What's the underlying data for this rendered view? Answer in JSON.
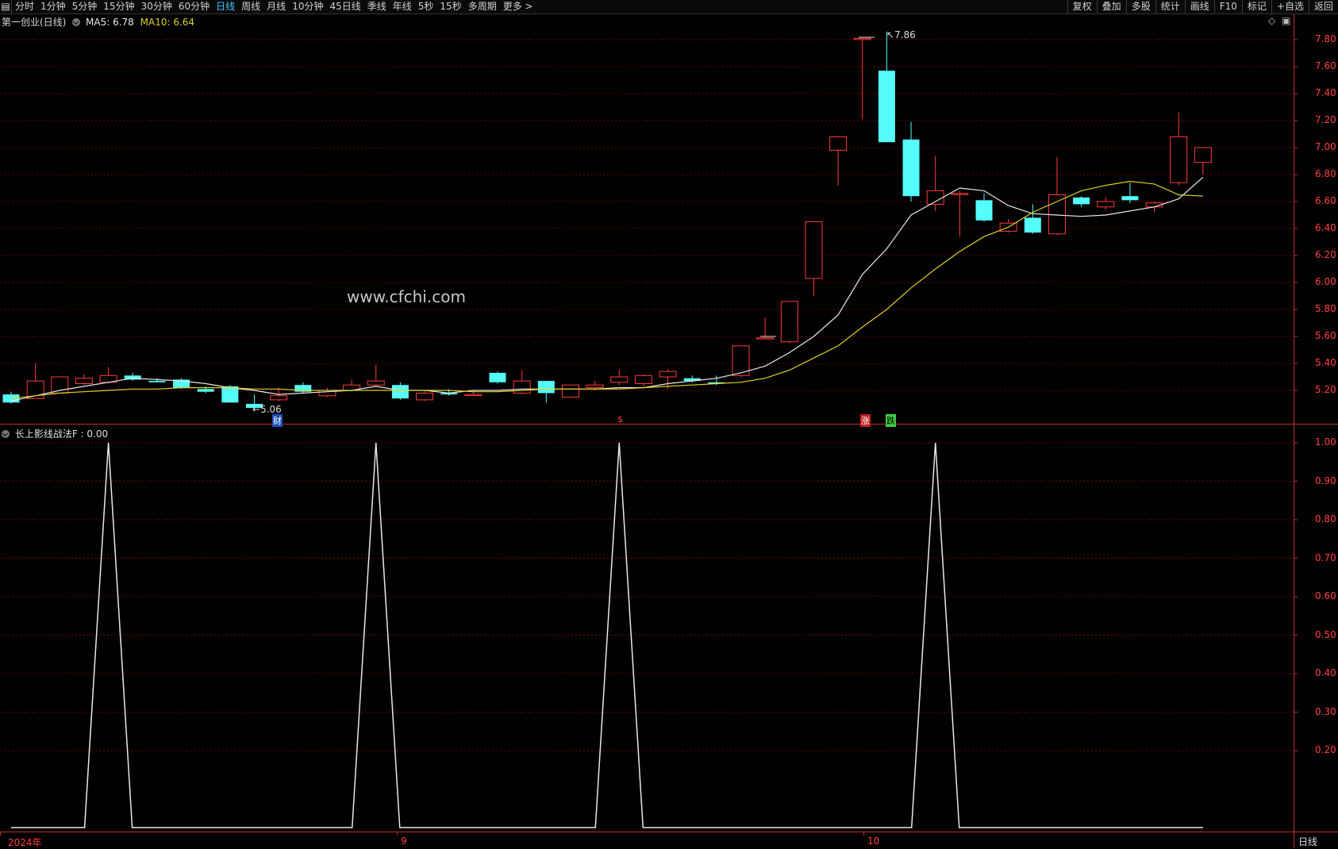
{
  "toolbar": {
    "left_tabs": [
      "分时",
      "1分钟",
      "5分钟",
      "15分钟",
      "30分钟",
      "60分钟",
      "日线",
      "周线",
      "月线",
      "10分钟",
      "45日线",
      "季线",
      "年线",
      "5秒",
      "15秒",
      "多周期",
      "更多 >"
    ],
    "active_tab": "日线",
    "right_buttons": [
      "复权",
      "叠加",
      "多股",
      "统计",
      "画线",
      "F10",
      "标记",
      "+自选",
      "返回"
    ]
  },
  "main_chart": {
    "stock_title": "第一创业(日线)",
    "ma5_label": "MA5: 6.78",
    "ma10_label": "MA10: 6.64",
    "high_annotation": "7.86",
    "low_annotation": "5.06",
    "event_markers": [
      "财",
      "$",
      "涨",
      "跌"
    ],
    "watermark": "www.cfchi.com",
    "colors": {
      "up": "#ff3b3b",
      "down": "#54fcfc",
      "ma5": "#e8e8e8",
      "ma10": "#e0d020",
      "grid": "#7a0000",
      "axis": "#ff4040"
    }
  },
  "indicator": {
    "title": "长上影线战法F : 0.00"
  },
  "x_axis": {
    "labels": [
      "2024年",
      "9",
      "10"
    ],
    "period_label": "日线"
  },
  "chart_data": [
    {
      "type": "candlestick",
      "title": "第一创业(日线)",
      "ylim": [
        5.0,
        7.9
      ],
      "y_ticks": [
        "7.80",
        "7.60",
        "7.40",
        "7.20",
        "7.00",
        "6.80",
        "6.60",
        "6.40",
        "6.20",
        "6.00",
        "5.80",
        "5.60",
        "5.40",
        "5.20"
      ],
      "candles": [
        [
          5.17,
          5.11,
          5.19,
          5.1
        ],
        [
          5.14,
          5.27,
          5.4,
          5.14
        ],
        [
          5.18,
          5.3,
          5.3,
          5.18
        ],
        [
          5.25,
          5.29,
          5.32,
          5.24
        ],
        [
          5.26,
          5.31,
          5.37,
          5.25
        ],
        [
          5.31,
          5.28,
          5.33,
          5.27
        ],
        [
          5.27,
          5.26,
          5.29,
          5.26
        ],
        [
          5.28,
          5.22,
          5.29,
          5.21
        ],
        [
          5.21,
          5.19,
          5.23,
          5.18
        ],
        [
          5.23,
          5.11,
          5.24,
          5.11
        ],
        [
          5.1,
          5.07,
          5.17,
          5.06
        ],
        [
          5.13,
          5.16,
          5.22,
          5.12
        ],
        [
          5.24,
          5.19,
          5.26,
          5.18
        ],
        [
          5.16,
          5.2,
          5.22,
          5.15
        ],
        [
          5.2,
          5.24,
          5.28,
          5.19
        ],
        [
          5.24,
          5.27,
          5.39,
          5.23
        ],
        [
          5.24,
          5.14,
          5.26,
          5.13
        ],
        [
          5.13,
          5.18,
          5.2,
          5.12
        ],
        [
          5.18,
          5.17,
          5.21,
          5.16
        ],
        [
          5.17,
          5.17,
          5.2,
          5.16
        ],
        [
          5.33,
          5.26,
          5.34,
          5.25
        ],
        [
          5.18,
          5.27,
          5.35,
          5.17
        ],
        [
          5.27,
          5.18,
          5.27,
          5.11
        ],
        [
          5.15,
          5.24,
          5.24,
          5.15
        ],
        [
          5.22,
          5.24,
          5.27,
          5.2
        ],
        [
          5.26,
          5.3,
          5.35,
          5.24
        ],
        [
          5.25,
          5.31,
          5.32,
          5.23
        ],
        [
          5.3,
          5.34,
          5.36,
          5.21
        ],
        [
          5.29,
          5.27,
          5.31,
          5.26
        ],
        [
          5.26,
          5.25,
          5.31,
          5.24
        ],
        [
          5.31,
          5.53,
          5.53,
          5.3
        ],
        [
          5.59,
          5.59,
          5.74,
          5.59
        ],
        [
          5.56,
          5.86,
          5.86,
          5.55
        ],
        [
          6.03,
          6.45,
          6.45,
          5.9
        ],
        [
          6.98,
          7.08,
          7.08,
          6.72
        ],
        [
          7.81,
          7.81,
          7.81,
          7.21
        ],
        [
          7.57,
          7.04,
          7.86,
          7.04
        ],
        [
          7.06,
          6.64,
          7.19,
          6.6
        ],
        [
          6.58,
          6.68,
          6.94,
          6.53
        ],
        [
          6.66,
          6.66,
          6.68,
          6.34
        ],
        [
          6.61,
          6.46,
          6.66,
          6.45
        ],
        [
          6.38,
          6.44,
          6.47,
          6.37
        ],
        [
          6.48,
          6.37,
          6.58,
          6.36
        ],
        [
          6.36,
          6.65,
          6.93,
          6.35
        ],
        [
          6.63,
          6.58,
          6.64,
          6.56
        ],
        [
          6.56,
          6.6,
          6.63,
          6.54
        ],
        [
          6.64,
          6.61,
          6.74,
          6.59
        ],
        [
          6.56,
          6.59,
          6.6,
          6.52
        ],
        [
          6.74,
          7.08,
          7.26,
          6.72
        ],
        [
          6.89,
          7.0,
          7.0,
          6.8
        ]
      ],
      "series": [
        {
          "name": "MA5",
          "values": [
            5.12,
            5.16,
            5.2,
            5.23,
            5.26,
            5.29,
            5.28,
            5.27,
            5.25,
            5.22,
            5.2,
            5.17,
            5.18,
            5.19,
            5.2,
            5.23,
            5.2,
            5.2,
            5.18,
            5.2,
            5.2,
            5.21,
            5.21,
            5.21,
            5.21,
            5.22,
            5.22,
            5.25,
            5.27,
            5.29,
            5.33,
            5.38,
            5.48,
            5.6,
            5.76,
            6.06,
            6.25,
            6.5,
            6.6,
            6.7,
            6.68,
            6.57,
            6.51,
            6.5,
            6.49,
            6.5,
            6.53,
            6.56,
            6.62,
            6.78
          ]
        },
        {
          "name": "MA10",
          "values": [
            5.14,
            5.16,
            5.18,
            5.19,
            5.2,
            5.21,
            5.21,
            5.22,
            5.22,
            5.22,
            5.21,
            5.21,
            5.2,
            5.2,
            5.2,
            5.2,
            5.2,
            5.2,
            5.2,
            5.19,
            5.19,
            5.2,
            5.21,
            5.21,
            5.21,
            5.21,
            5.22,
            5.23,
            5.24,
            5.25,
            5.26,
            5.29,
            5.35,
            5.44,
            5.53,
            5.67,
            5.8,
            5.96,
            6.1,
            6.23,
            6.34,
            6.41,
            6.52,
            6.6,
            6.68,
            6.72,
            6.75,
            6.73,
            6.65,
            6.64
          ]
        }
      ]
    },
    {
      "type": "line",
      "title": "长上影线战法F : 0.00",
      "ylim": [
        0,
        1.0
      ],
      "y_ticks": [
        "1.00",
        "0.90",
        "0.80",
        "0.70",
        "0.60",
        "0.50",
        "0.40",
        "0.30",
        "0.20"
      ],
      "series": [
        {
          "name": "长上影线战法F",
          "values": [
            0,
            0,
            0,
            0,
            1,
            0,
            0,
            0,
            0,
            0,
            0,
            0,
            0,
            0,
            0,
            1,
            0,
            0,
            0,
            0,
            0,
            0,
            0,
            0,
            0,
            1,
            0,
            0,
            0,
            0,
            0,
            0,
            0,
            0,
            0,
            0,
            0,
            0,
            1,
            0,
            0,
            0,
            0,
            0,
            0,
            0,
            0,
            0,
            0,
            0
          ]
        }
      ]
    }
  ]
}
